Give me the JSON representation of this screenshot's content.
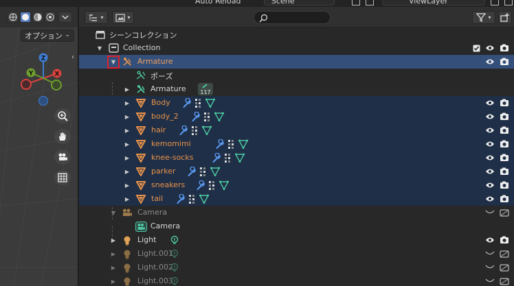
{
  "topbar": {
    "auto_reload_label": "Auto Reload",
    "scene_value": "Scene",
    "view_layer_value": "ViewLayer"
  },
  "viewport": {
    "options_label": "オプション",
    "axis_labels": {
      "z": "Z",
      "y": "Y",
      "x": "X"
    },
    "axis_colors": {
      "x": "#d9423d",
      "y": "#6e9e2c",
      "z": "#3e7ed6"
    }
  },
  "outliner": {
    "search_placeholder": "",
    "scene_collection_label": "シーンコレクション",
    "rows": [
      {
        "label": "Collection"
      },
      {
        "label": "Armature"
      },
      {
        "label": "ポーズ"
      },
      {
        "label": "Armature",
        "badge": "117"
      },
      {
        "label": "Body"
      },
      {
        "label": "body_2"
      },
      {
        "label": "hair"
      },
      {
        "label": "kemomimi"
      },
      {
        "label": "knee-socks"
      },
      {
        "label": "parker"
      },
      {
        "label": "sneakers"
      },
      {
        "label": "tail"
      },
      {
        "label": "Camera"
      },
      {
        "label": "Camera"
      },
      {
        "label": "Light"
      },
      {
        "label": "Light.001"
      },
      {
        "label": "Light.002"
      },
      {
        "label": "Light.003"
      }
    ],
    "colors": {
      "selected": "#334f7a",
      "highlight": "#1f2f47",
      "mesh_orange": "#e8924a",
      "modifier_blue": "#5b9bf2",
      "vertex_green": "#4cc9a2"
    }
  }
}
